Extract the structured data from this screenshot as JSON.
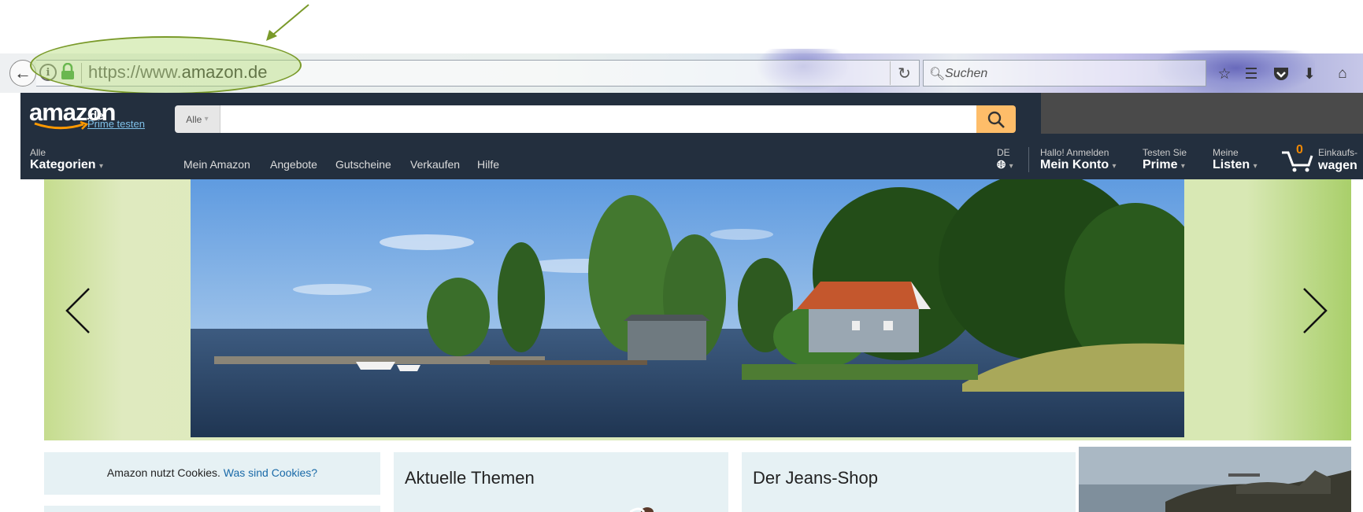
{
  "browser": {
    "url_prefix": "https://www.",
    "url_domain": "amazon.de",
    "search_placeholder": "Suchen"
  },
  "amazon": {
    "logo": "amazon",
    "logo_suffix": ".de",
    "prime_link": "Prime testen",
    "search_scope": "Alle",
    "search_value": "",
    "nav": {
      "categories_small": "Alle",
      "categories_big": "Kategorien",
      "links": [
        "Mein Amazon",
        "Angebote",
        "Gutscheine",
        "Verkaufen",
        "Hilfe"
      ],
      "lang_small": "DE",
      "account_small": "Hallo! Anmelden",
      "account_big": "Mein Konto",
      "prime_small": "Testen Sie",
      "prime_big": "Prime",
      "lists_small": "Meine",
      "lists_big": "Listen",
      "cart_count": "0",
      "cart_small": "Einkaufs-",
      "cart_big": "wagen"
    },
    "accent": "#febd69",
    "header_bg": "#232f3e"
  },
  "cards": {
    "cookie_text": "Amazon nutzt Cookies.",
    "cookie_link": "Was sind Cookies?",
    "card2_title": "Aktuelle Themen",
    "card3_title": "Der Jeans-Shop"
  }
}
